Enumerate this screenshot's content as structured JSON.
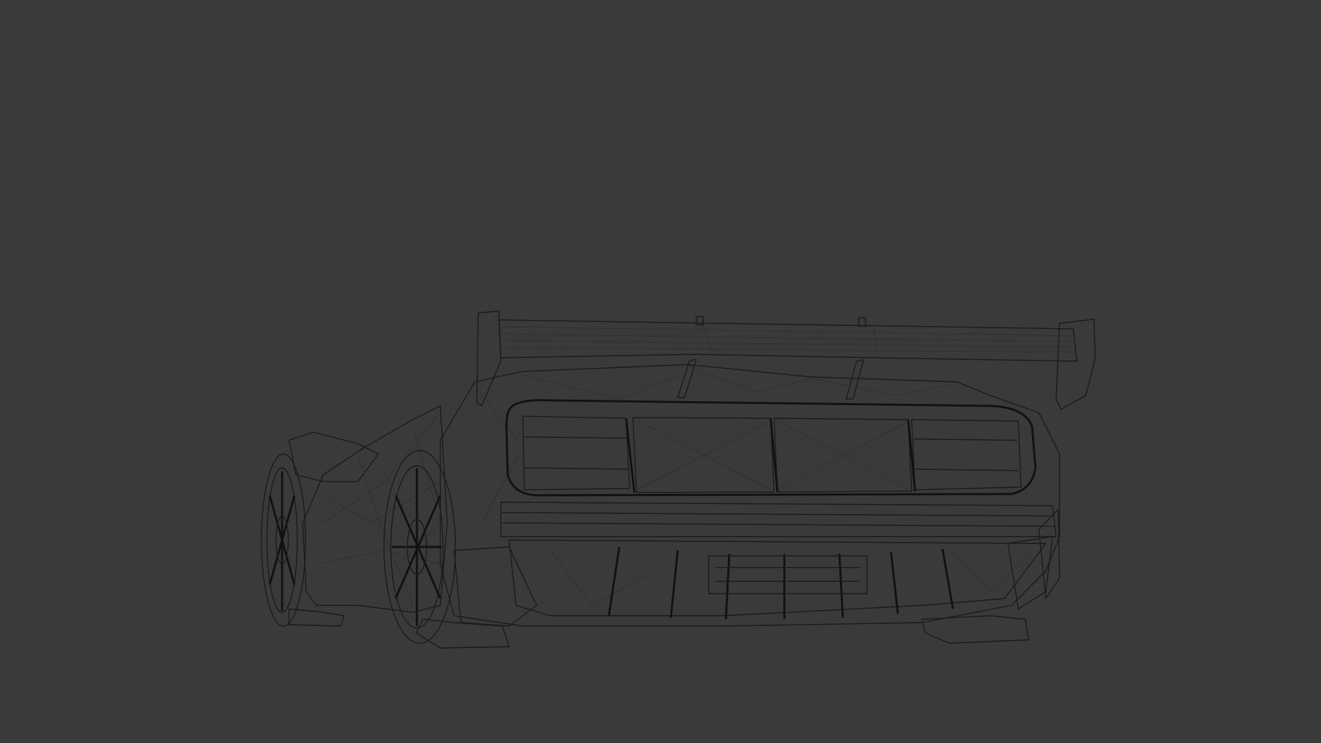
{
  "viewport": {
    "background_color": "#3a3a3a",
    "model_fill_color": "#c8c8c8",
    "wire_color": "#1a1a1a",
    "render_mode": "wireframe"
  }
}
